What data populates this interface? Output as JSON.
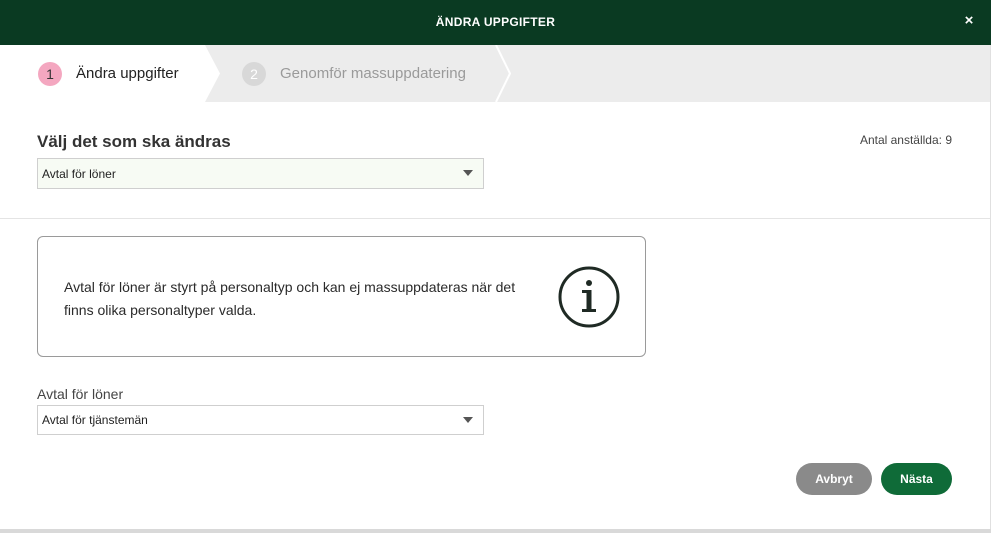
{
  "dialog": {
    "title": "ÄNDRA UPPGIFTER",
    "close_glyph": "×"
  },
  "stepper": {
    "steps": [
      {
        "number": "1",
        "label": "Ändra uppgifter",
        "active": true
      },
      {
        "number": "2",
        "label": "Genomför massuppdatering",
        "active": false
      }
    ]
  },
  "section": {
    "title": "Välj det som ska ändras",
    "employee_count": "Antal anställda: 9",
    "selected_option": "Avtal för löner"
  },
  "info": {
    "message": "Avtal för löner är styrt på personaltyp och kan ej massuppdateras när det finns olika personaltyper valda.",
    "icon": "info-icon"
  },
  "field": {
    "label": "Avtal för löner",
    "value": "Avtal för tjänstemän"
  },
  "buttons": {
    "cancel": "Avbryt",
    "next": "Nästa"
  },
  "colors": {
    "header": "#0a3a22",
    "active_step": "#f4a7c0",
    "next_button": "#0f6b38",
    "cancel_button": "#8a8a8a"
  }
}
